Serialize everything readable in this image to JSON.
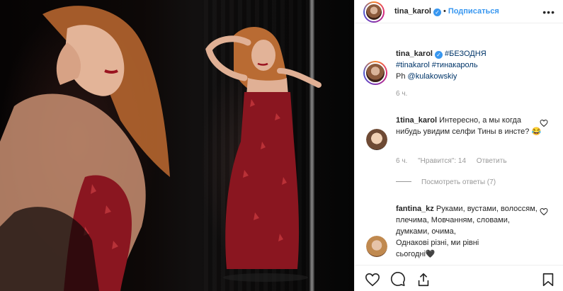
{
  "header": {
    "username": "tina_karol",
    "verified_icon": "verified-badge-icon",
    "separator": "•",
    "follow_label": "Подписаться",
    "more_icon": "more-options-icon",
    "more_glyph": "•••"
  },
  "caption": {
    "username": "tina_karol",
    "hashtag1": "#БЕЗОДНЯ",
    "hashtag2": "#tinakarol",
    "hashtag3": "#тинакароль",
    "credit_prefix": "Ph",
    "credit_mention": "@kulakowskiy",
    "time": "6 ч."
  },
  "comments": [
    {
      "username": "1tina_karol",
      "text": "Интересно, а мы когда нибудь увидим селфи Тины в инсте? 😂",
      "time": "6 ч.",
      "likes": "\"Нравится\": 14",
      "reply_label": "Ответить",
      "view_replies": "Посмотреть ответы (7)"
    },
    {
      "username": "fantina_kz",
      "text": "Руками, вустами, волоссям, плечима, Мовчанням, словами, думками, очима,",
      "text2": "Однакові різні, ми рівні",
      "text3": "сьогодні🖤"
    }
  ],
  "actions": {
    "like_icon": "heart-icon",
    "comment_icon": "comment-icon",
    "share_icon": "share-icon",
    "save_icon": "bookmark-icon"
  },
  "colors": {
    "link": "#3897f0",
    "hashtag": "#003569",
    "muted": "#999999",
    "dress": "#8a1620"
  }
}
